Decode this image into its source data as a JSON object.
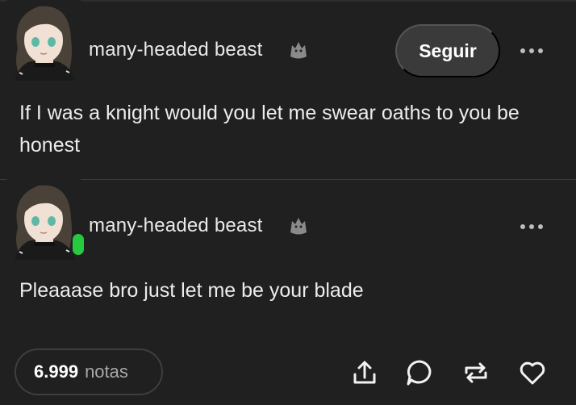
{
  "posts": [
    {
      "username": "many-headed beast",
      "follow_label": "Seguir",
      "text": "If I was a knight would you let me swear oaths to you be honest"
    },
    {
      "username": "many-headed beast",
      "text": "Pleaaase bro just let me be your blade"
    }
  ],
  "footer": {
    "notes_count": "6.999",
    "notes_label": "notas"
  },
  "colors": {
    "background": "#202020",
    "online": "#27c93f",
    "button": "#3a3a3a"
  },
  "icons": [
    "wolf-icon",
    "more-options-icon",
    "share-icon",
    "reply-icon",
    "reblog-icon",
    "like-icon"
  ]
}
